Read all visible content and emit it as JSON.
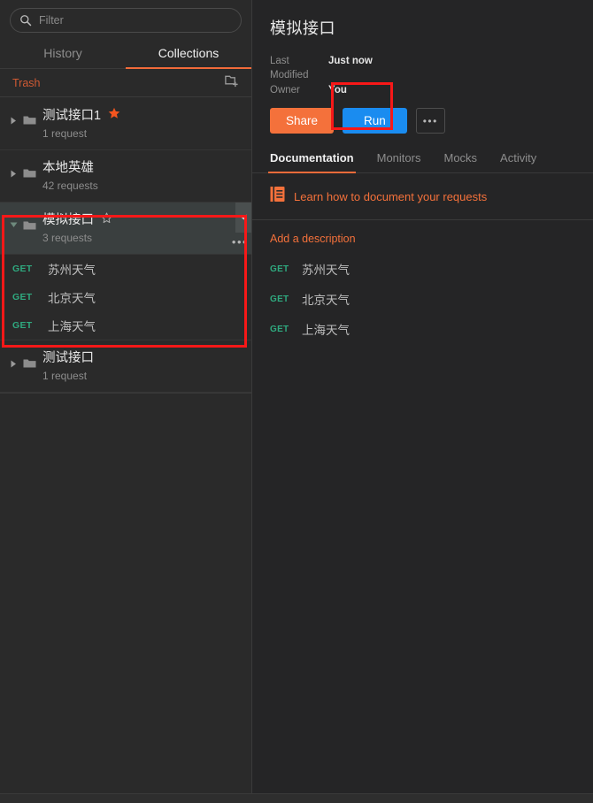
{
  "sidebar": {
    "search": {
      "placeholder": "Filter",
      "value": "",
      "icon": "search-icon"
    },
    "tabs": [
      {
        "label": "History",
        "active": false
      },
      {
        "label": "Collections",
        "active": true
      }
    ],
    "trash": {
      "label": "Trash",
      "new_collection_icon": "new-collection-icon"
    },
    "collections": [
      {
        "name": "测试接口1",
        "count": "1 request",
        "starred": true,
        "selected": false,
        "expanded": false
      },
      {
        "name": "本地英雄",
        "count": "42 requests",
        "starred": false,
        "selected": false,
        "expanded": false
      },
      {
        "name": "模拟接口",
        "count": "3 requests",
        "starred": false,
        "star_state": "outline",
        "selected": true,
        "expanded": true,
        "requests": [
          {
            "method": "GET",
            "name": "苏州天气"
          },
          {
            "method": "GET",
            "name": "北京天气"
          },
          {
            "method": "GET",
            "name": "上海天气"
          }
        ]
      },
      {
        "name": "测试接口",
        "count": "1 request",
        "starred": false,
        "selected": false,
        "expanded": false
      }
    ]
  },
  "main": {
    "title": "模拟接口",
    "meta": [
      {
        "key": "Last Modified",
        "value": "Just now"
      },
      {
        "key": "Owner",
        "value": "You"
      }
    ],
    "buttons": {
      "share": "Share",
      "run": "Run",
      "more": "•••"
    },
    "tabs": [
      {
        "label": "Documentation",
        "active": true
      },
      {
        "label": "Monitors",
        "active": false
      },
      {
        "label": "Mocks",
        "active": false
      },
      {
        "label": "Activity",
        "active": false
      }
    ],
    "doc_hint": {
      "text": "Learn how to document your requests",
      "icon": "book-icon"
    },
    "add_description": "Add a description",
    "requests": [
      {
        "method": "GET",
        "name": "苏州天气"
      },
      {
        "method": "GET",
        "name": "北京天气"
      },
      {
        "method": "GET",
        "name": "上海天气"
      }
    ]
  },
  "colors": {
    "accent": "#f26b3a",
    "run_blue": "#1a8cf0",
    "method_get": "#2fa97f",
    "annotation": "#f71818",
    "star_filled": "#f4551f"
  }
}
